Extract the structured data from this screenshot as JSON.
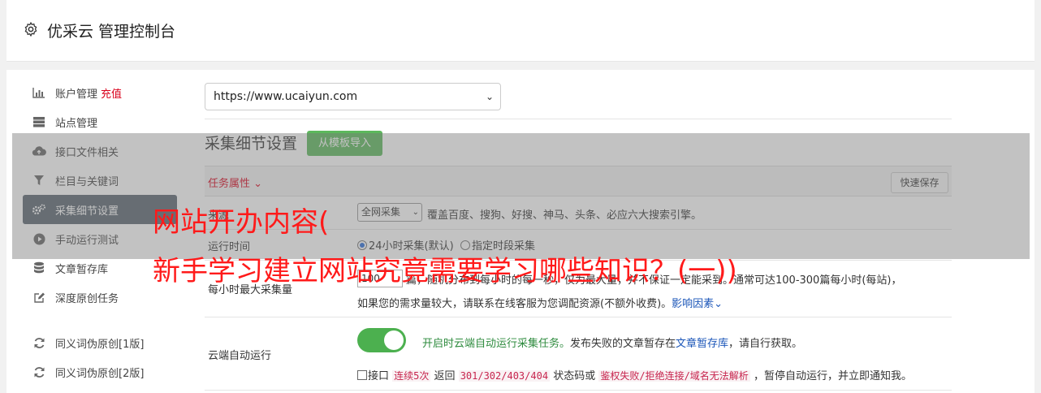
{
  "header": {
    "title": "优采云 管理控制台",
    "icon": "gear-icon"
  },
  "sidebar": {
    "items": [
      {
        "label": "账户管理",
        "tag": "充值",
        "icon": "bar-chart-icon"
      },
      {
        "label": "站点管理",
        "icon": "server-icon"
      },
      {
        "label": "接口文件相关",
        "icon": "cloud-upload-icon"
      },
      {
        "label": "栏目与关键词",
        "icon": "filter-icon"
      },
      {
        "label": "采集细节设置",
        "icon": "gears-icon",
        "active": true
      },
      {
        "label": "手动运行测试",
        "icon": "play-icon"
      },
      {
        "label": "文章暂存库",
        "icon": "database-icon"
      },
      {
        "label": "深度原创任务",
        "icon": "edit-icon"
      },
      {
        "label": "同义词伪原创[1版]",
        "icon": "refresh-icon"
      },
      {
        "label": "同义词伪原创[2版]",
        "icon": "refresh-icon"
      }
    ]
  },
  "site_select": {
    "value": "https://www.ucaiyun.com"
  },
  "section": {
    "title": "采集细节设置",
    "import_button": "从模板导入"
  },
  "task_bar": {
    "label": "任务属性",
    "quick_save": "快速保存"
  },
  "source": {
    "label": "来源",
    "select_value": "全网采集",
    "desc": "覆盖百度、搜狗、好搜、神马、头条、必应六大搜索引擎。"
  },
  "run_time": {
    "label": "运行时间",
    "option_1": "24小时采集(默认)",
    "option_2": "指定时段采集",
    "selected": "24小时采集(默认)"
  },
  "max_per_hour": {
    "label": "每小时最大采集量",
    "input_value": "100",
    "line_1": "篇，随机分布到每小时的每一秒，仅为最大量，并不保证一定能采到。通常可达100-300篇每小时(每站)，",
    "line_2": "如果您的需求量较大，请联系在线客服为您调配资源(不额外收费)。",
    "link": "影响因素"
  },
  "cloud_run": {
    "label": "云端自动运行",
    "toggle_on": true,
    "desc_prefix": "开启时云端自动运行采集任务。",
    "desc_mid": "发布失败的文章暂存在",
    "desc_link": "文章暂存库",
    "desc_suffix": "，请自行获取。",
    "chk_1": "接口",
    "code_1": "连续5次",
    "chk_2": "返回",
    "code_2": "301/302/403/404",
    "chk_3": "状态码或",
    "code_3": "鉴权失败/拒绝连接/域名无法解析",
    "chk_4": "，暂停自动运行，并立即通知我。"
  },
  "headline": {
    "line_1": "网站开办内容(",
    "line_2": "新手学习建立网站究竟需要学习哪些知识？(一))"
  }
}
